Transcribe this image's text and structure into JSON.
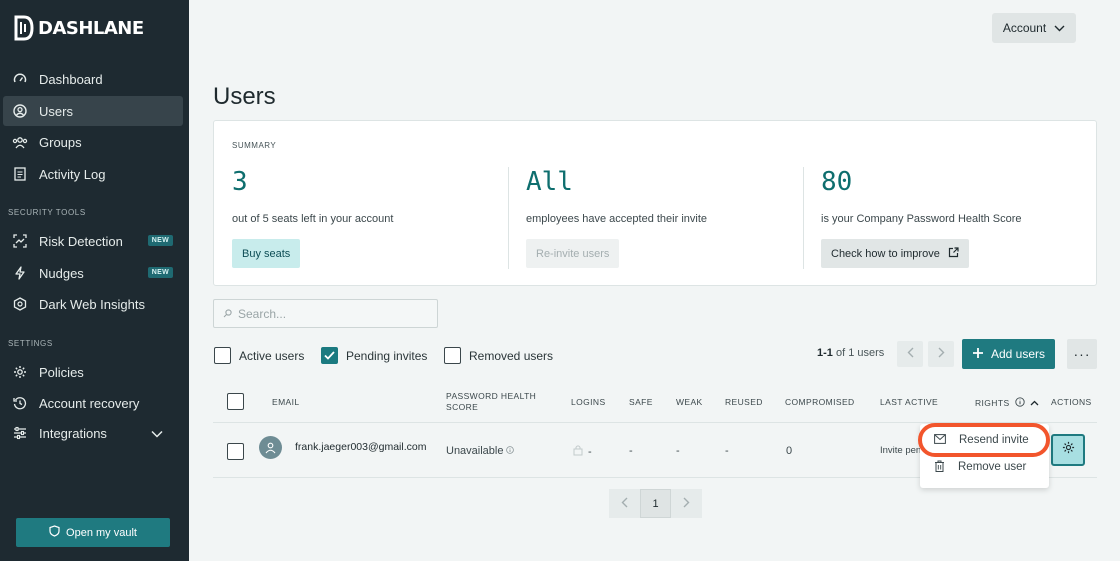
{
  "brand": {
    "name": "DASHLANE"
  },
  "sidebar": {
    "items": [
      {
        "label": "Dashboard",
        "icon": "gauge-icon"
      },
      {
        "label": "Users",
        "icon": "user-circle-icon",
        "active": true
      },
      {
        "label": "Groups",
        "icon": "groups-icon"
      },
      {
        "label": "Activity Log",
        "icon": "document-icon"
      }
    ],
    "security_label": "SECURITY TOOLS",
    "security_items": [
      {
        "label": "Risk Detection",
        "badge": "NEW",
        "icon": "risk-icon"
      },
      {
        "label": "Nudges",
        "badge": "NEW",
        "icon": "bolt-icon"
      },
      {
        "label": "Dark Web Insights",
        "icon": "web-icon"
      }
    ],
    "settings_label": "SETTINGS",
    "settings_items": [
      {
        "label": "Policies",
        "icon": "gear-icon"
      },
      {
        "label": "Account recovery",
        "icon": "history-icon"
      },
      {
        "label": "Integrations",
        "icon": "sliders-icon"
      }
    ],
    "vault_button": "Open my vault"
  },
  "header": {
    "account_label": "Account"
  },
  "page": {
    "title": "Users"
  },
  "summary": {
    "label": "SUMMARY",
    "stats": [
      {
        "value": "3",
        "desc": "out of 5 seats left in your account",
        "button": "Buy seats"
      },
      {
        "value": "All",
        "desc": "employees have accepted their invite",
        "button": "Re-invite users"
      },
      {
        "value": "80",
        "desc": "is your Company Password Health Score",
        "button": "Check how to improve"
      }
    ]
  },
  "search": {
    "placeholder": "Search..."
  },
  "filters": [
    {
      "label": "Active users",
      "checked": false
    },
    {
      "label": "Pending invites",
      "checked": true
    },
    {
      "label": "Removed users",
      "checked": false
    }
  ],
  "pagination_info": {
    "range": "1-1",
    "rest": "of 1 users"
  },
  "toolbar": {
    "add_users": "Add users",
    "more": "···"
  },
  "table": {
    "headers": [
      "EMAIL",
      "PASSWORD HEALTH SCORE",
      "LOGINS",
      "SAFE",
      "WEAK",
      "REUSED",
      "COMPROMISED",
      "LAST ACTIVE",
      "RIGHTS",
      "ACTIONS"
    ],
    "rows": [
      {
        "email": "frank.jaeger003@gmail.com",
        "health": "Unavailable",
        "logins": "-",
        "safe": "-",
        "weak": "-",
        "reused": "-",
        "compromised": "0",
        "last_active": "Invite pending"
      }
    ]
  },
  "action_menu": {
    "resend": "Resend invite",
    "remove": "Remove user"
  },
  "pager": {
    "current": "1"
  },
  "colors": {
    "accent": "#1f7a80",
    "sidebar": "#1e2a31",
    "highlight": "#f2552c"
  }
}
